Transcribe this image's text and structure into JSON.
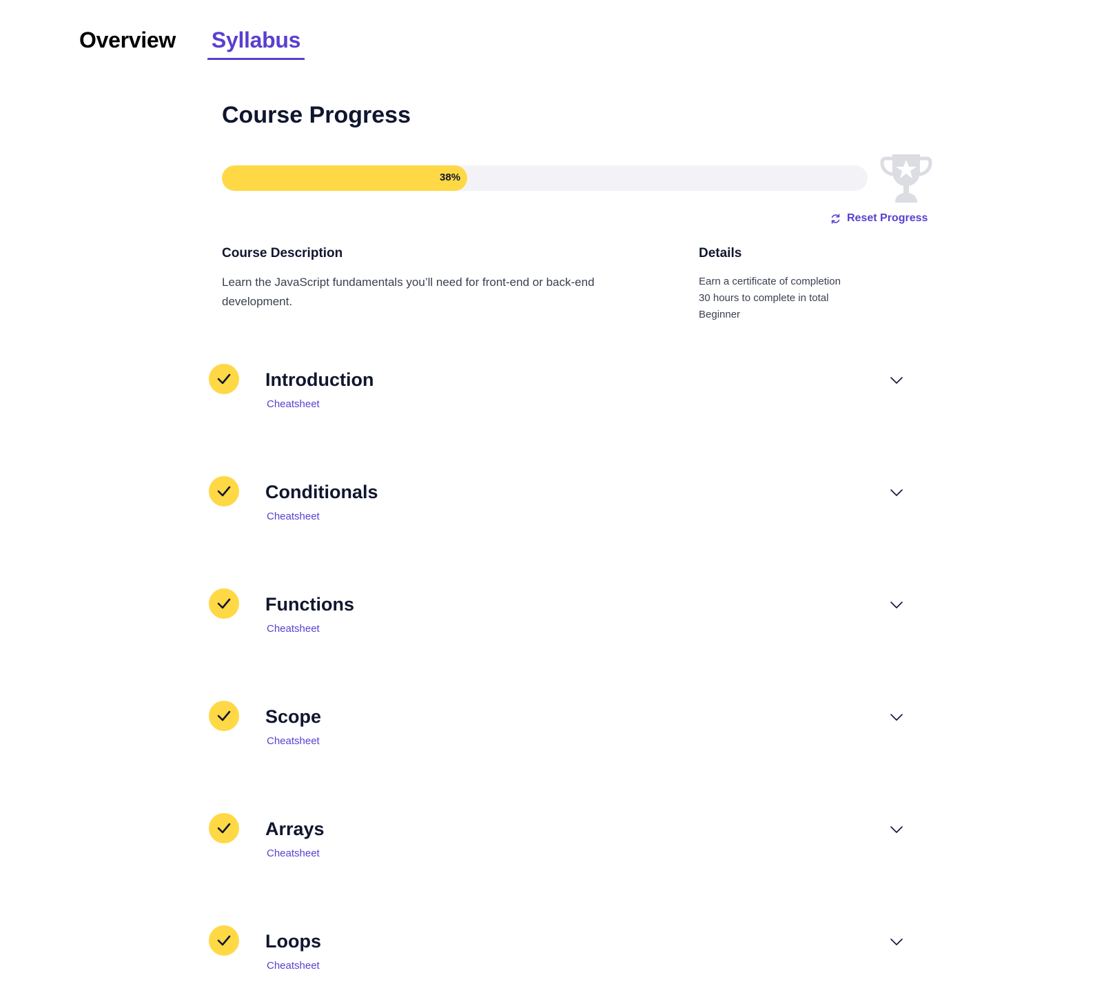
{
  "tabs": [
    {
      "label": "Overview",
      "active": false
    },
    {
      "label": "Syllabus",
      "active": true
    }
  ],
  "progress": {
    "title": "Course Progress",
    "percent": 38,
    "percent_label": "38%",
    "reset_label": "Reset Progress"
  },
  "description": {
    "heading": "Course Description",
    "text": "Learn the JavaScript fundamentals you’ll need for front-end or back-end development."
  },
  "details": {
    "heading": "Details",
    "items": [
      "Earn a certificate of completion",
      "30 hours to complete in total",
      "Beginner"
    ]
  },
  "modules": [
    {
      "title": "Introduction",
      "link": "Cheatsheet",
      "completed": true
    },
    {
      "title": "Conditionals",
      "link": "Cheatsheet",
      "completed": true
    },
    {
      "title": "Functions",
      "link": "Cheatsheet",
      "completed": true
    },
    {
      "title": "Scope",
      "link": "Cheatsheet",
      "completed": true
    },
    {
      "title": "Arrays",
      "link": "Cheatsheet",
      "completed": true
    },
    {
      "title": "Loops",
      "link": "Cheatsheet",
      "completed": true
    }
  ],
  "icons": {
    "trophy": "trophy-icon",
    "reset": "refresh-icon",
    "check": "check-icon",
    "chevron": "chevron-down-icon"
  },
  "colors": {
    "accent": "#5a3fd0",
    "progress_fill": "#ffd845",
    "progress_track": "#f3f3f7",
    "check_bg": "#ffd845",
    "text": "#10162f"
  }
}
